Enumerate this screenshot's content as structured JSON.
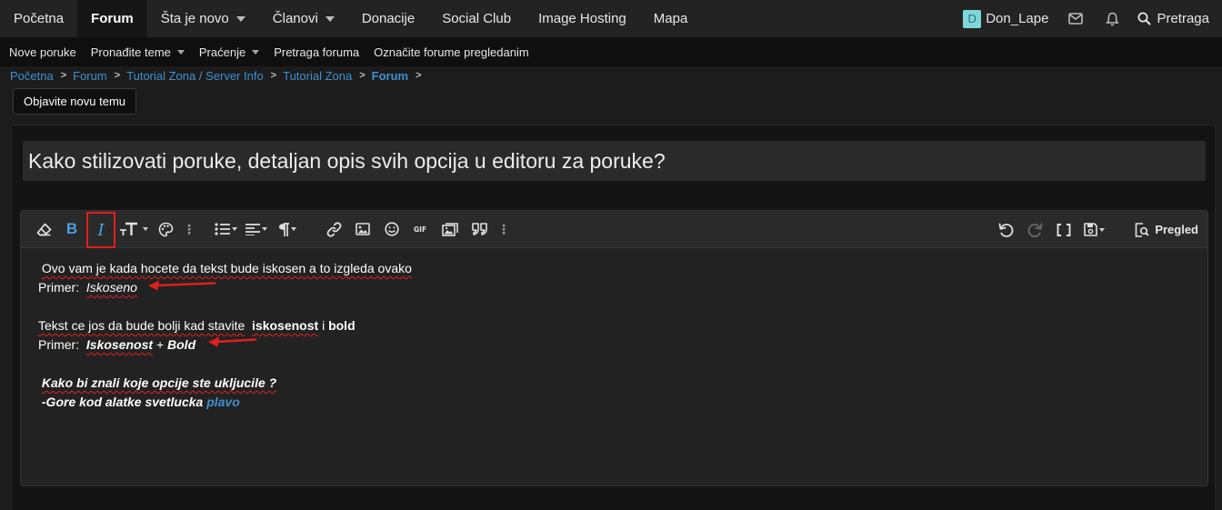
{
  "nav": {
    "tabs": [
      {
        "label": "Početna",
        "caret": false
      },
      {
        "label": "Forum",
        "caret": false,
        "active": true
      },
      {
        "label": "Šta je novo",
        "caret": true
      },
      {
        "label": "Članovi",
        "caret": true
      },
      {
        "label": "Donacije",
        "caret": false
      },
      {
        "label": "Social Club",
        "caret": false
      },
      {
        "label": "Image Hosting",
        "caret": false
      },
      {
        "label": "Mapa",
        "caret": false
      }
    ],
    "avatar_letter": "D",
    "username": "Don_Lape",
    "search_label": "Pretraga"
  },
  "subnav": {
    "items": [
      {
        "label": "Nove poruke",
        "caret": false
      },
      {
        "label": "Pronađite teme",
        "caret": true
      },
      {
        "label": "Praćenje",
        "caret": true
      },
      {
        "label": "Pretraga foruma",
        "caret": false
      },
      {
        "label": "Označite forume pregledanim",
        "caret": false
      }
    ]
  },
  "breadcrumb": [
    "Početna",
    "Forum",
    "Tutorial Zona / Server Info",
    "Tutorial Zona",
    "Forum"
  ],
  "new_thread_label": "Objavite novu temu",
  "thread": {
    "title": "Kako stilizovati poruke, detaljan opis svih opcija u editoru za poruke?"
  },
  "toolbar": {
    "bold_label": "B",
    "italic_label": "I",
    "preview_label": "Pregled"
  },
  "editor": {
    "line1": "Ovo vam je kada hocete da tekst bude iskosen a to izgleda ovako",
    "example_label": "Primer:",
    "italic_example": "Iskoseno",
    "line3_prefix": "Tekst ce jos da bude bolji kad stavite",
    "line3_word1": "iskosenost",
    "line3_and": "i",
    "line3_word2": "bold",
    "example2_label": "Primer:",
    "example2_word1": "Iskosenost",
    "example2_plus": "+",
    "example2_word2": "Bold",
    "question": "Kako bi znali koje opcije ste ukljucile ?",
    "answer_prefix": "-Gore kod alatke svetlucka",
    "answer_blue": "plavo"
  },
  "colors": {
    "accent": "#3e8fd0",
    "highlight_box": "#e21d1d"
  }
}
